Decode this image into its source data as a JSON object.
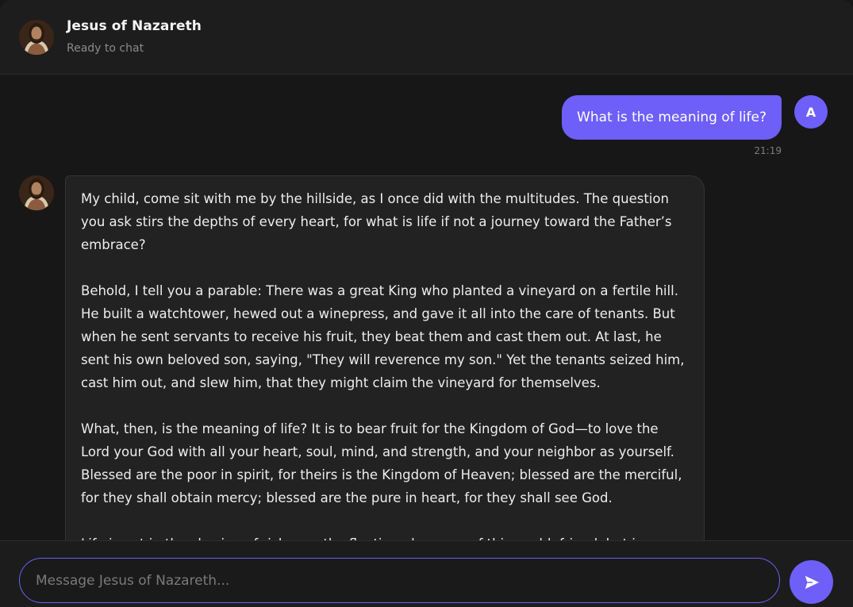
{
  "header": {
    "title": "Jesus of Nazareth",
    "status": "Ready to chat"
  },
  "conversation": {
    "user_message": {
      "text": "What is the meaning of life?",
      "time": "21:19",
      "avatar_letter": "A"
    },
    "bot_message": {
      "paragraphs": [
        "My child, come sit with me by the hillside, as I once did with the multitudes. The question you ask stirs the depths of every heart, for what is life if not a journey toward the Father’s embrace?",
        "Behold, I tell you a parable: There was a great King who planted a vineyard on a fertile hill. He built a watchtower, hewed out a winepress, and gave it all into the care of tenants. But when he sent servants to receive his fruit, they beat them and cast them out. At last, he sent his own beloved son, saying, \"They will reverence my son.\" Yet the tenants seized him, cast him out, and slew him, that they might claim the vineyard for themselves.",
        "What, then, is the meaning of life? It is to bear fruit for the Kingdom of God—to love the Lord your God with all your heart, soul, mind, and strength, and your neighbor as yourself. Blessed are the poor in spirit, for theirs is the Kingdom of Heaven; blessed are the merciful, for they shall obtain mercy; blessed are the pure in heart, for they shall see God.",
        "Life is not in the chasing of riches or the fleeting pleasures of this world, friend, but in"
      ]
    }
  },
  "composer": {
    "placeholder": "Message Jesus of Nazareth...",
    "value": ""
  },
  "icons": {
    "send": "send-icon",
    "avatar": "avatar-jesus"
  },
  "colors": {
    "accent": "#6d5ff7",
    "background": "#171717",
    "bubble": "#222222"
  }
}
